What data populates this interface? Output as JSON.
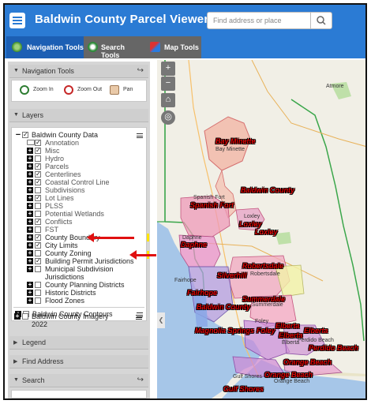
{
  "header": {
    "title": "Baldwin County Parcel Viewer",
    "search_placeholder": "Find address or place"
  },
  "tabs": [
    {
      "label": "Navigation Tools"
    },
    {
      "label": "Search Tools"
    },
    {
      "label": "Map Tools"
    }
  ],
  "panel": {
    "navigation_tools": {
      "title": "Navigation Tools",
      "zoom_in": "Zoom In",
      "zoom_out": "Zoom Out",
      "pan": "Pan"
    },
    "layers": {
      "title": "Layers",
      "items": [
        {
          "label": "Baldwin County Data"
        },
        {
          "label": "Annotation"
        },
        {
          "label": "Misc"
        },
        {
          "label": "Hydro"
        },
        {
          "label": "Parcels"
        },
        {
          "label": "Centerlines"
        },
        {
          "label": "Coastal Control Line"
        },
        {
          "label": "Subdivisions"
        },
        {
          "label": "Lot Lines"
        },
        {
          "label": "PLSS"
        },
        {
          "label": "Potential Wetlands"
        },
        {
          "label": "Conflicts"
        },
        {
          "label": "FST"
        },
        {
          "label": "County Boundary"
        },
        {
          "label": "City Limits"
        },
        {
          "label": "County Zoning"
        },
        {
          "label": "Building Permit Jurisdictions"
        },
        {
          "label": "Municipal Subdivision"
        },
        {
          "label": "Jurisdictions"
        },
        {
          "label": "County Planning Districts"
        },
        {
          "label": "Historic Districts"
        },
        {
          "label": "Flood Zones"
        },
        {
          "label": "Baldwin County Contours"
        },
        {
          "label": "Baldwin County Imagery"
        },
        {
          "label": "2022"
        }
      ]
    },
    "legend": {
      "title": "Legend"
    },
    "find_address": {
      "title": "Find Address"
    },
    "search": {
      "title": "Search"
    }
  },
  "map": {
    "jurisdiction_labels": [
      {
        "text": "Bay Minette"
      },
      {
        "text": "Baldwin County"
      },
      {
        "text": "Spanish Fort"
      },
      {
        "text": "Loxley"
      },
      {
        "text": "Loxley"
      },
      {
        "text": "Daphne"
      },
      {
        "text": "Robertsdale"
      },
      {
        "text": "Silverhill"
      },
      {
        "text": "Fairhope"
      },
      {
        "text": "Summerdale"
      },
      {
        "text": "Baldwin County"
      },
      {
        "text": "Magnolia Springs"
      },
      {
        "text": "Foley"
      },
      {
        "text": "Elberta"
      },
      {
        "text": "Elberta"
      },
      {
        "text": "Elberta"
      },
      {
        "text": "Perdido Beach"
      },
      {
        "text": "Orange Beach"
      },
      {
        "text": "Orange Beach"
      },
      {
        "text": "Gulf Shores"
      }
    ],
    "place_labels": [
      {
        "text": "Atmore"
      },
      {
        "text": "Bay Minette"
      },
      {
        "text": "Spanish Fort"
      },
      {
        "text": "Loxley"
      },
      {
        "text": "Daphne"
      },
      {
        "text": "Robertsdale"
      },
      {
        "text": "Fairhope"
      },
      {
        "text": "Summerdale"
      },
      {
        "text": "Foley"
      },
      {
        "text": "Elberta"
      },
      {
        "text": "Perdido Beach"
      },
      {
        "text": "Orange Beach"
      },
      {
        "text": "Gulf Shores"
      }
    ]
  },
  "colors": {
    "header": "#2b7bd4",
    "active_tab": "#1c5fb4",
    "highlight": "#ffe400",
    "annotation_arrow": "#e01010",
    "label_red": "#e30000"
  },
  "icons": [
    "menu-icon",
    "search-icon",
    "compass-icon",
    "zoom-in-icon",
    "zoom-out-icon",
    "pan-hand-icon",
    "home-icon",
    "locate-icon",
    "share-icon"
  ]
}
